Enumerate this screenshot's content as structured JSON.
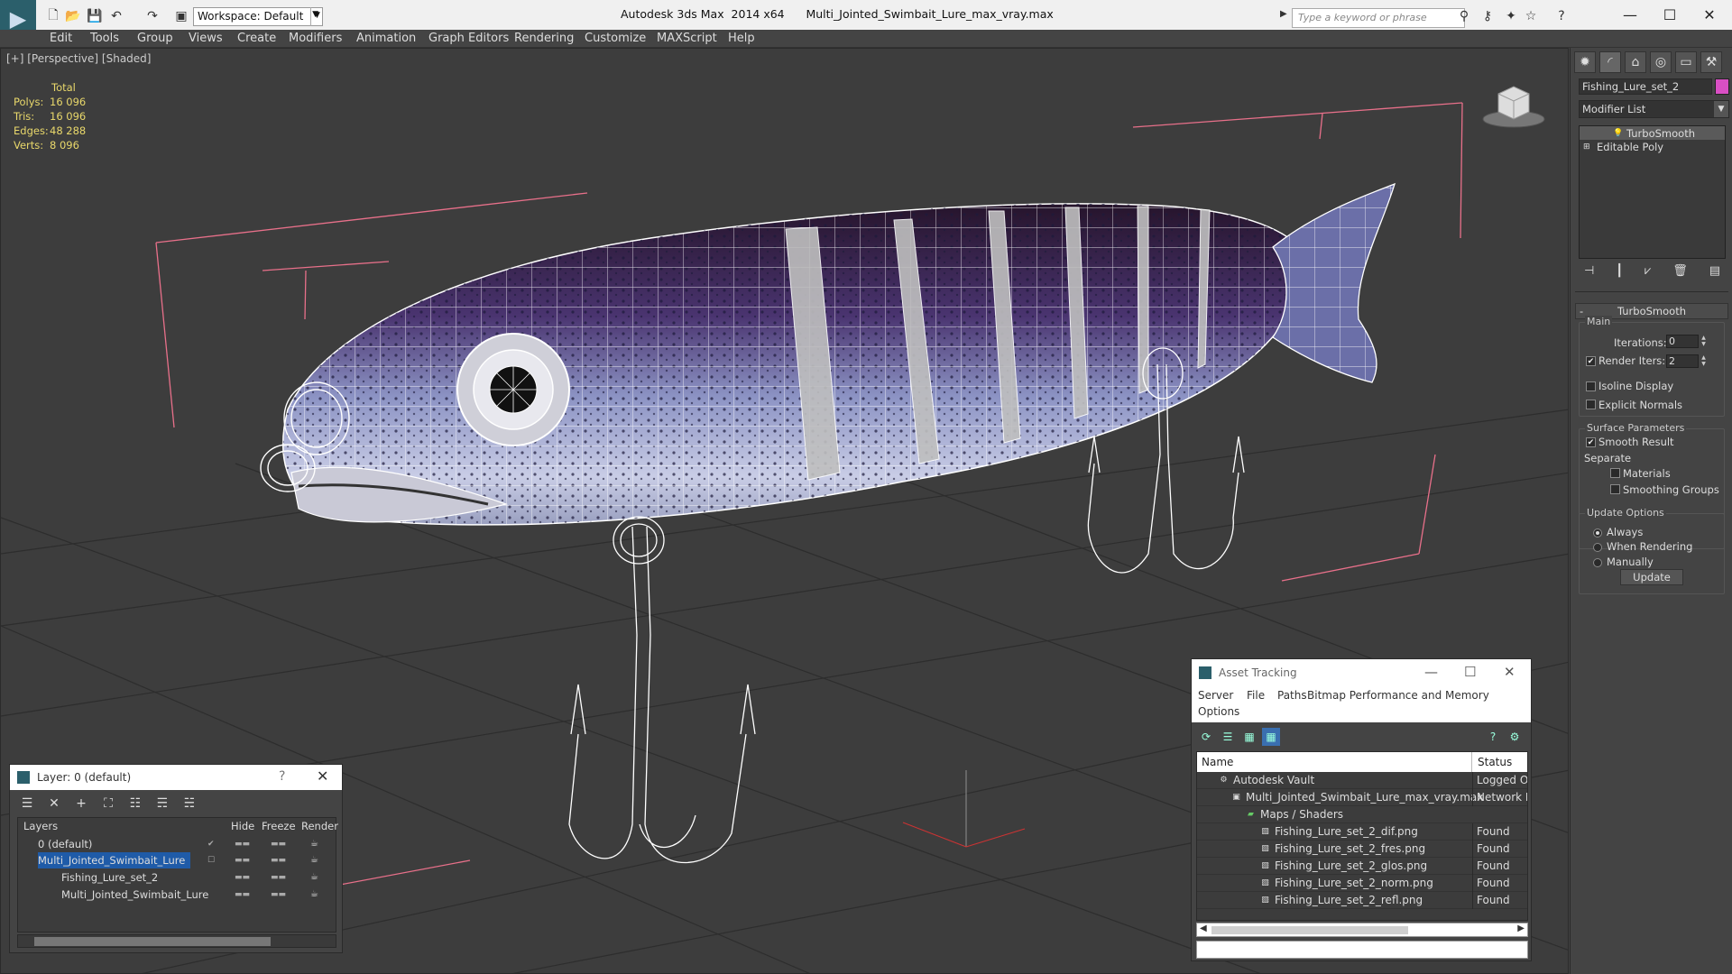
{
  "titlebar": {
    "workspace": "Workspace: Default",
    "title": "Autodesk 3ds Max  2014 x64      Multi_Jointed_Swimbait_Lure_max_vray.max",
    "search_placeholder": "Type a keyword or phrase"
  },
  "menu": [
    "Edit",
    "Tools",
    "Group",
    "Views",
    "Create",
    "Modifiers",
    "Animation",
    "Graph Editors",
    "Rendering",
    "Customize",
    "MAXScript",
    "Help"
  ],
  "viewport": {
    "label": "[+] [Perspective] [Shaded]",
    "stats": {
      "header": "Total",
      "polys_label": "Polys:",
      "polys": "16 096",
      "tris_label": "Tris:",
      "tris": "16 096",
      "edges_label": "Edges:",
      "edges": "48 288",
      "verts_label": "Verts:",
      "verts": "8 096"
    },
    "selection_box_color": "#e8708a",
    "wireframe_color": "#ffffff"
  },
  "command_panel": {
    "object_name": "Fishing_Lure_set_2",
    "object_color": "#d94fc4",
    "modifier_list": "Modifier List",
    "stack": [
      "TurboSmooth",
      "Editable Poly"
    ],
    "rollout": "TurboSmooth",
    "main_group": "Main",
    "iterations_label": "Iterations:",
    "iterations": "0",
    "render_iters_label": "Render Iters:",
    "render_iters": "2",
    "isoline_label": "Isoline Display",
    "explicit_normals_label": "Explicit Normals",
    "surface_group": "Surface Parameters",
    "smooth_result_label": "Smooth Result",
    "separate_label": "Separate",
    "materials_label": "Materials",
    "smoothing_groups_label": "Smoothing Groups",
    "update_group": "Update Options",
    "always_label": "Always",
    "when_rendering_label": "When Rendering",
    "manually_label": "Manually",
    "update_button": "Update",
    "checks": {
      "render_iters": true,
      "isoline": false,
      "explicit_normals": false,
      "smooth_result": true,
      "materials": false,
      "smoothing_groups": false
    }
  },
  "layer_panel": {
    "title": "Layer: 0 (default)",
    "help": "?",
    "columns": {
      "layers": "Layers",
      "hide": "Hide",
      "freeze": "Freeze",
      "render": "Render"
    },
    "rows": [
      {
        "name": "0 (default)",
        "selected": false
      },
      {
        "name": "Multi_Jointed_Swimbait_Lure",
        "selected": true
      },
      {
        "name": "Fishing_Lure_set_2",
        "selected": false
      },
      {
        "name": "Multi_Jointed_Swimbait_Lure",
        "selected": false
      }
    ]
  },
  "asset_tracking": {
    "title": "Asset Tracking",
    "menu": [
      "Server",
      "File",
      "Paths",
      "Bitmap Performance and Memory",
      "Options"
    ],
    "columns": {
      "name": "Name",
      "status": "Status"
    },
    "rows": [
      {
        "name": "Autodesk Vault",
        "status": "Logged Ou"
      },
      {
        "name": "Multi_Jointed_Swimbait_Lure_max_vray.max",
        "status": "Network Pa"
      },
      {
        "name": "Maps / Shaders",
        "status": ""
      },
      {
        "name": "Fishing_Lure_set_2_dif.png",
        "status": "Found"
      },
      {
        "name": "Fishing_Lure_set_2_fres.png",
        "status": "Found"
      },
      {
        "name": "Fishing_Lure_set_2_glos.png",
        "status": "Found"
      },
      {
        "name": "Fishing_Lure_set_2_norm.png",
        "status": "Found"
      },
      {
        "name": "Fishing_Lure_set_2_refl.png",
        "status": "Found"
      }
    ]
  }
}
